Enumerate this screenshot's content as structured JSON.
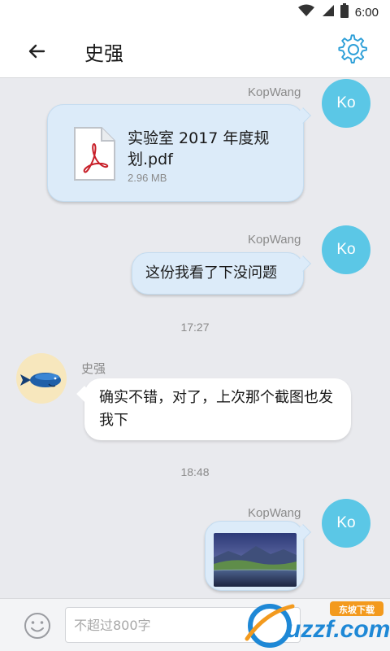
{
  "status_bar": {
    "time": "6:00",
    "icons": [
      "wifi-icon",
      "cell-signal-icon",
      "battery-icon"
    ]
  },
  "header": {
    "title": "史强",
    "back_icon": "back-arrow-icon",
    "settings_icon": "gear-icon"
  },
  "messages": [
    {
      "type": "file",
      "direction": "outgoing",
      "sender": "KopWang",
      "avatar_text": "Ko",
      "file_name": "实验室 2017 年度规划.pdf",
      "file_size": "2.96 MB",
      "file_icon": "pdf-file-icon"
    },
    {
      "type": "text",
      "direction": "outgoing",
      "sender": "KopWang",
      "avatar_text": "Ko",
      "text": "这份我看了下没问题"
    },
    {
      "type": "timestamp",
      "text": "17:27"
    },
    {
      "type": "text",
      "direction": "incoming",
      "sender": "史强",
      "avatar_icon": "whale-avatar-icon",
      "text": "确实不错，对了，上次那个截图也发我下"
    },
    {
      "type": "timestamp",
      "text": "18:48"
    },
    {
      "type": "image",
      "direction": "outgoing",
      "sender": "KopWang",
      "avatar_text": "Ko",
      "image_icon": "landscape-photo"
    }
  ],
  "input_bar": {
    "emoji_icon": "smiley-icon",
    "placeholder": "不超过800字",
    "value": ""
  },
  "watermark": {
    "text": "uzzf.com",
    "sub_text": "东坡下载"
  },
  "colors": {
    "accent": "#5bc7e6",
    "outgoing_bubble": "#dcebf9",
    "incoming_bubble": "#ffffff",
    "background": "#e9eaee",
    "settings_icon": "#2d9fd8",
    "pdf_red": "#c8202a"
  }
}
